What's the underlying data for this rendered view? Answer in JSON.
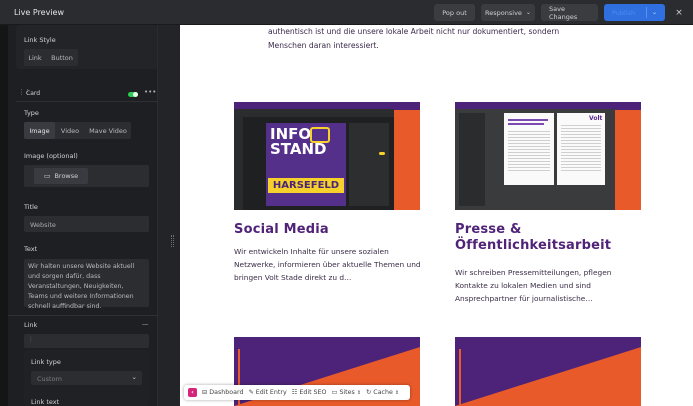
{
  "topbar": {
    "title": "Live Preview",
    "popout": "Pop out",
    "responsive": "Responsive",
    "save": "Save Changes",
    "publish": "Publish",
    "close": "×"
  },
  "sidebar": {
    "link_style": {
      "label": "Link Style",
      "options": [
        "Link",
        "Button"
      ]
    },
    "card": {
      "label": "Card",
      "enabled": true
    },
    "type": {
      "label": "Type",
      "options": [
        "Image",
        "Video",
        "Mave Video"
      ],
      "selected": "Image"
    },
    "image": {
      "label": "Image (optional)",
      "browse": "Browse"
    },
    "title": {
      "label": "Title",
      "value": "Website"
    },
    "text": {
      "label": "Text",
      "value": "Wir halten unsere Website aktuell und sorgen dafür, dass Veranstaltungen, Neuigkeiten, Teams und weitere Informationen schnell auffindbar sind."
    },
    "link": {
      "label": "Link",
      "collapse": "—",
      "link_type_label": "Link type",
      "link_type_value": "Custom",
      "link_text_label": "Link text"
    }
  },
  "preview": {
    "intro": "authentisch ist und die unsere lokale Arbeit nicht nur dokumentiert, sondern Menschen daran interessiert.",
    "cards": [
      {
        "title": "Social Media",
        "text": "Wir entwickeln Inhalte für unsere sozialen Netzwerke, informieren über aktuelle Themen und bringen Volt Stade direkt zu d…",
        "image_caption": [
          "INFO",
          "STAND",
          "HARSEFELD"
        ]
      },
      {
        "title": "Presse & Öffentlichkeitsarbeit",
        "text": "Wir schreiben Pressemitteilungen, pflegen Kontakte zu lokalen Medien und sind Ansprechpartner für journalistische…",
        "image_caption": [
          "Volt"
        ]
      }
    ]
  },
  "bottombar": {
    "dashboard": "Dashboard",
    "edit_entry": "Edit Entry",
    "edit_seo": "Edit SEO",
    "sites": "Sites",
    "cache": "Cache"
  },
  "colors": {
    "brand_purple": "#502379",
    "accent_orange": "#e85a2a",
    "publish_blue": "#2f6fe0",
    "toggle_green": "#2ec95a"
  }
}
